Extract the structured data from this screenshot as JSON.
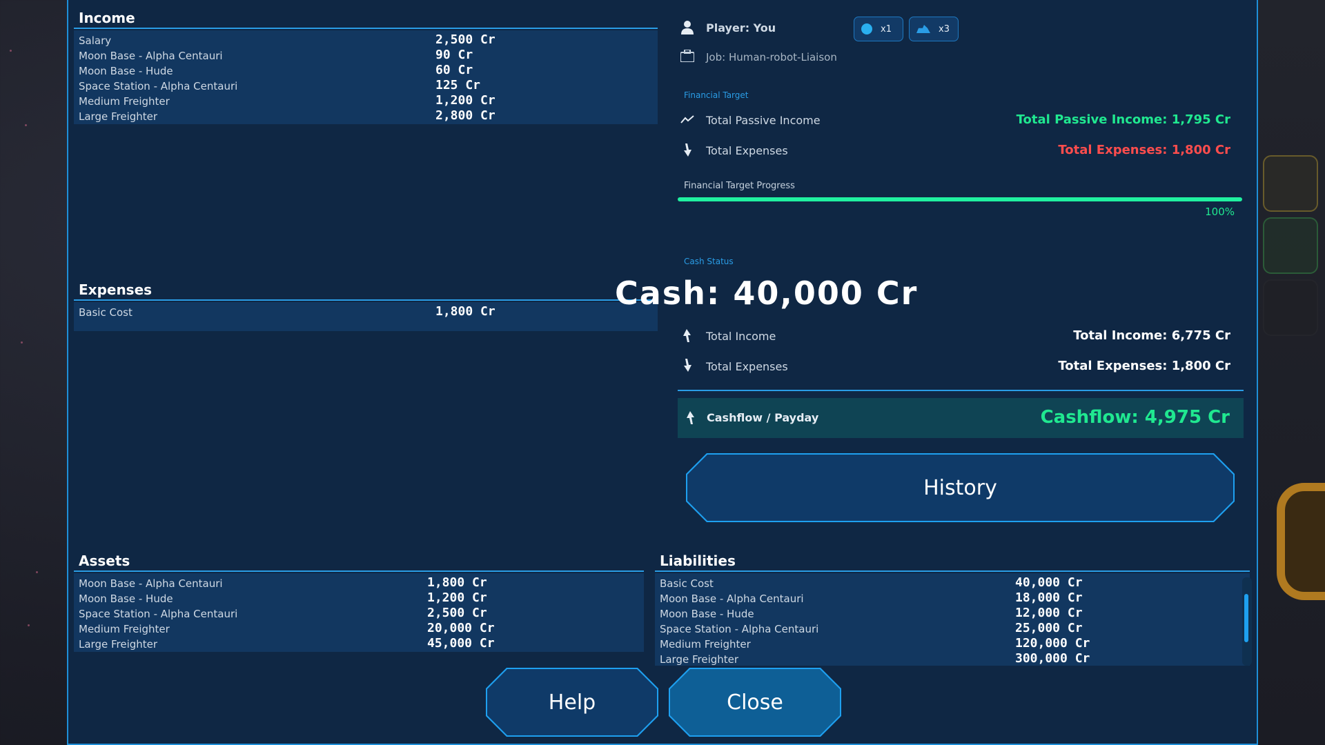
{
  "income": {
    "title": "Income",
    "rows": [
      {
        "label": "Salary",
        "value": "2,500 Cr"
      },
      {
        "label": "Moon Base - Alpha Centauri",
        "value": "90 Cr"
      },
      {
        "label": "Moon Base - Hude",
        "value": "60 Cr"
      },
      {
        "label": "Space Station - Alpha Centauri",
        "value": "125 Cr"
      },
      {
        "label": "Medium Freighter",
        "value": "1,200 Cr"
      },
      {
        "label": "Large Freighter",
        "value": "2,800 Cr"
      }
    ]
  },
  "expenses": {
    "title": "Expenses",
    "rows": [
      {
        "label": "Basic Cost",
        "value": "1,800 Cr"
      }
    ]
  },
  "assets": {
    "title": "Assets",
    "rows": [
      {
        "label": "Moon Base - Alpha Centauri",
        "value": "1,800 Cr"
      },
      {
        "label": "Moon Base - Hude",
        "value": "1,200 Cr"
      },
      {
        "label": "Space Station - Alpha Centauri",
        "value": "2,500 Cr"
      },
      {
        "label": "Medium Freighter",
        "value": "20,000 Cr"
      },
      {
        "label": "Large Freighter",
        "value": "45,000 Cr"
      }
    ]
  },
  "liabilities": {
    "title": "Liabilities",
    "rows": [
      {
        "label": "Basic Cost",
        "value": "40,000 Cr"
      },
      {
        "label": "Moon Base - Alpha Centauri",
        "value": "18,000 Cr"
      },
      {
        "label": "Moon Base - Hude",
        "value": "12,000 Cr"
      },
      {
        "label": "Space Station - Alpha Centauri",
        "value": "25,000 Cr"
      },
      {
        "label": "Medium Freighter",
        "value": "120,000 Cr"
      },
      {
        "label": "Large Freighter",
        "value": "300,000 Cr"
      }
    ]
  },
  "player": {
    "name": "Player: You",
    "job": "Job: Human-robot-Liaison",
    "badges": [
      {
        "icon": "orb-icon",
        "count": "x1"
      },
      {
        "icon": "ship-icon",
        "count": "x3"
      }
    ]
  },
  "financial_target": {
    "section_label": "Financial Target",
    "passive_label": "Total Passive Income",
    "passive_value": "Total Passive Income: 1,795 Cr",
    "expenses_label": "Total Expenses",
    "expenses_value": "Total Expenses: 1,800 Cr",
    "progress_label": "Financial Target Progress",
    "progress_percent": 100,
    "progress_text": "100%"
  },
  "cash_status": {
    "section_label": "Cash Status",
    "cash": "Cash: 40,000 Cr",
    "income_label": "Total Income",
    "income_value": "Total Income: 6,775 Cr",
    "expenses_label": "Total Expenses",
    "expenses_value": "Total Expenses: 1,800 Cr",
    "cashflow_label": "Cashflow / Payday",
    "cashflow_value": "Cashflow: 4,975 Cr"
  },
  "buttons": {
    "history": "History",
    "help": "Help",
    "close": "Close"
  },
  "colors": {
    "accent": "#1ea0f0",
    "positive": "#20e890",
    "negative": "#ff4d4d",
    "panel": "#0f2744"
  }
}
